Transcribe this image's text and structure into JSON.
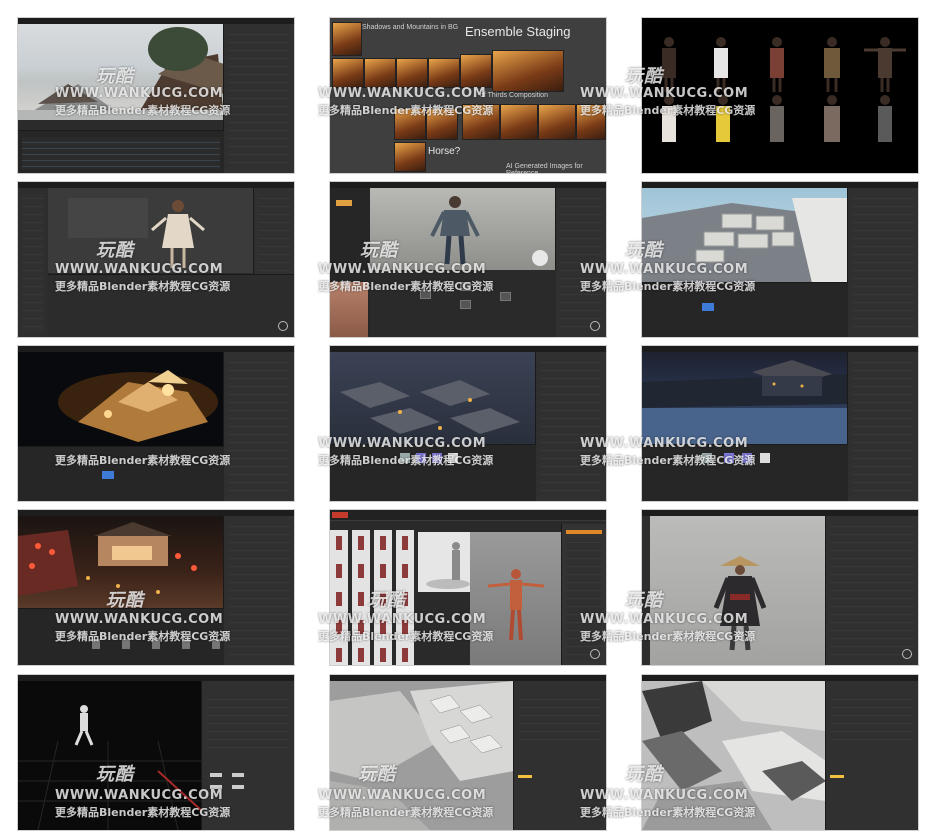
{
  "watermark": {
    "logo": "玩酷",
    "url": "WWW.WANKUCG.COM",
    "subtitle": "更多精品Blender素材教程CG资源"
  },
  "collage": {
    "title": "Ensemble Staging",
    "label_top": "Shadows and Mountains in BG",
    "label_mid": "of Thirds Composition",
    "label_horse": "Horse?",
    "label_bottom": "AI Generated Images for Reference"
  },
  "colors": {
    "ui_dark": "#2b2b2b",
    "ui_panel": "#303030",
    "accent_blue": "#3d7bd6",
    "warm_light": "#f0b04a",
    "night_blue": "#2a3550"
  },
  "tiles": [
    {
      "name": "tile-village-overview",
      "icon": "blender-ui"
    },
    {
      "name": "tile-ai-reference-collage",
      "icon": "image-collage"
    },
    {
      "name": "tile-character-lineup",
      "icon": "characters"
    },
    {
      "name": "tile-character-editor",
      "icon": "blender-ui"
    },
    {
      "name": "tile-face-sculpt",
      "icon": "blender-ui"
    },
    {
      "name": "tile-block-layout",
      "icon": "blender-ui"
    },
    {
      "name": "tile-night-lighting",
      "icon": "blender-ui"
    },
    {
      "name": "tile-village-aerial-night",
      "icon": "blender-ui"
    },
    {
      "name": "tile-snow-village-night",
      "icon": "blender-ui"
    },
    {
      "name": "tile-street-lanterns",
      "icon": "blender-ui"
    },
    {
      "name": "tile-animation-poses",
      "icon": "animation"
    },
    {
      "name": "tile-ronin-character",
      "icon": "blender-ui"
    },
    {
      "name": "tile-walk-cycle-grid",
      "icon": "blender-ui"
    },
    {
      "name": "tile-clay-village-top",
      "icon": "blender-ui"
    },
    {
      "name": "tile-clay-village-zoom",
      "icon": "blender-ui"
    }
  ]
}
